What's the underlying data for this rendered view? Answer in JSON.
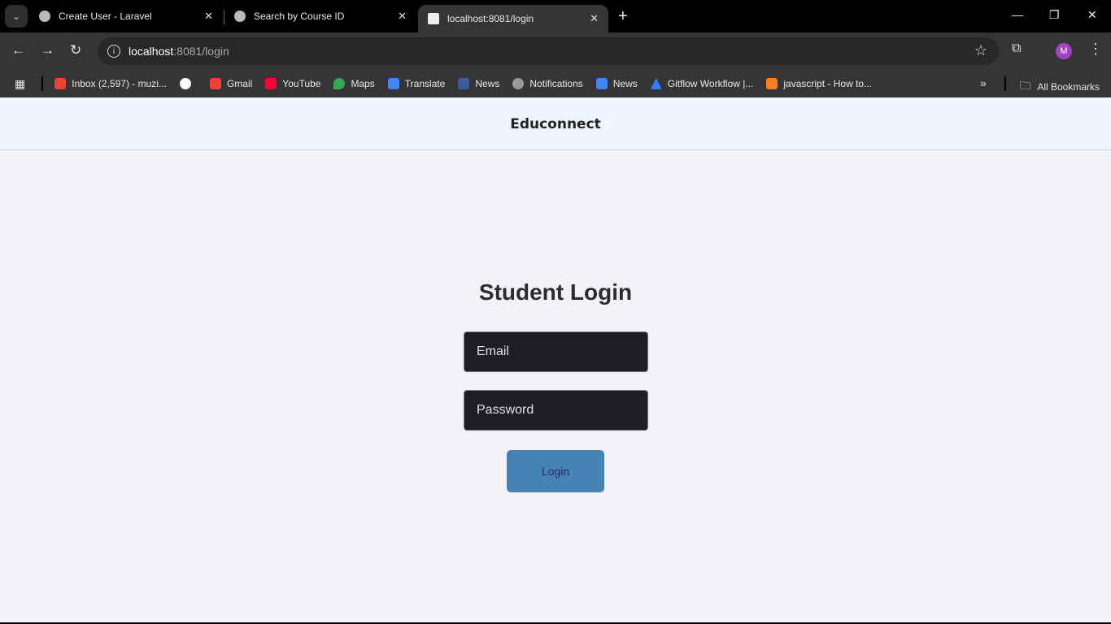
{
  "browser": {
    "tabs": [
      {
        "title": "Create User - Laravel",
        "active": false
      },
      {
        "title": "Search by Course ID",
        "active": false
      },
      {
        "title": "localhost:8081/login",
        "active": true
      }
    ],
    "url_host": "localhost",
    "url_rest": ":8081/login",
    "profile_initial": "M",
    "bookmarks": [
      {
        "label": "Inbox (2,597) - muzi...",
        "color": "#ea4335"
      },
      {
        "label": "",
        "color": "#4285f4"
      },
      {
        "label": "Gmail",
        "color": "#ea4335"
      },
      {
        "label": "YouTube",
        "color": "#ff0033"
      },
      {
        "label": "Maps",
        "color": "#34a853"
      },
      {
        "label": "Translate",
        "color": "#4285f4"
      },
      {
        "label": "News",
        "color": "#3a5ba0"
      },
      {
        "label": "Notifications",
        "color": "#999999"
      },
      {
        "label": "News",
        "color": "#4285f4"
      },
      {
        "label": "Gitflow Workflow |...",
        "color": "#2684ff"
      },
      {
        "label": "javascript - How to...",
        "color": "#f48024"
      }
    ],
    "all_bookmarks": "All Bookmarks"
  },
  "page": {
    "brand": "Educonnect",
    "title": "Student Login",
    "email_placeholder": "Email",
    "password_placeholder": "Password",
    "login_label": "Login",
    "button_color": "#4682b4"
  }
}
